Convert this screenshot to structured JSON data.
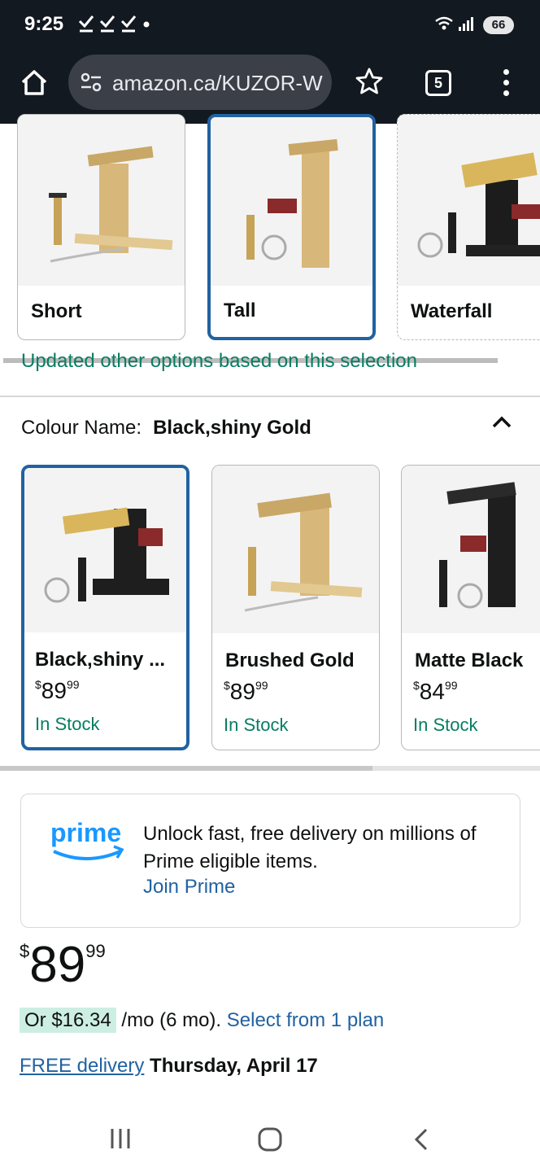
{
  "status_bar": {
    "time": "9:25",
    "notification_icons": [
      "check-icon",
      "check-icon",
      "check-icon",
      "dot-icon"
    ],
    "battery": "66"
  },
  "browser": {
    "url": "amazon.ca/KUZOR-W",
    "tab_count": "5"
  },
  "style_options": [
    {
      "label": "Short",
      "selected": false
    },
    {
      "label": "Tall",
      "selected": true
    },
    {
      "label": "Waterfall",
      "selected": false
    }
  ],
  "updated_notice": "Updated other options based on this selection",
  "colour": {
    "prefix": "Colour Name:",
    "selected_value": "Black,shiny Gold"
  },
  "colour_options": [
    {
      "label": "Black,shiny ...",
      "price_dollars": "89",
      "price_cents": "99",
      "currency": "$",
      "stock": "In Stock",
      "selected": true
    },
    {
      "label": "Brushed Gold",
      "price_dollars": "89",
      "price_cents": "99",
      "currency": "$",
      "stock": "In Stock",
      "selected": false
    },
    {
      "label": "Matte Black",
      "price_dollars": "84",
      "price_cents": "99",
      "currency": "$",
      "stock": "In Stock",
      "selected": false
    }
  ],
  "prime": {
    "logo_text": "prime",
    "text": "Unlock fast, free delivery on millions of Prime eligible items.",
    "link": "Join Prime"
  },
  "price": {
    "currency": "$",
    "whole": "89",
    "fraction": "99"
  },
  "installment": {
    "amount": "Or $16.34",
    "term": "/mo (6 mo).",
    "link": "Select from 1 plan"
  },
  "delivery": {
    "link": "FREE delivery",
    "date": "Thursday, April 17"
  },
  "colors": {
    "accent_blue": "#2162a1",
    "in_stock_green": "#067d62",
    "prime_blue": "#1a98ff",
    "chrome_dark": "#131921"
  }
}
